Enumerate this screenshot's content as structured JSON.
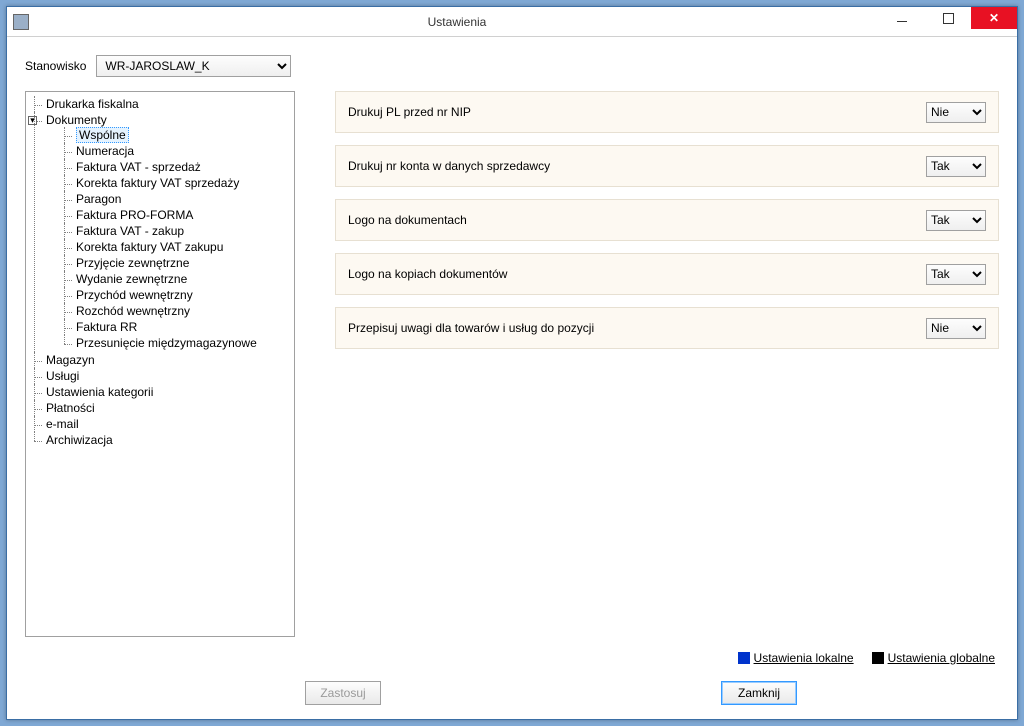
{
  "window": {
    "title": "Ustawienia"
  },
  "stanowisko": {
    "label": "Stanowisko",
    "value": "WR-JAROSLAW_K"
  },
  "tree": {
    "root": [
      {
        "label": "Drukarka fiskalna"
      },
      {
        "label": "Dokumenty",
        "expanded": true,
        "children": [
          {
            "label": "Wspólne",
            "selected": true
          },
          {
            "label": "Numeracja"
          },
          {
            "label": "Faktura VAT - sprzedaż"
          },
          {
            "label": "Korekta faktury VAT sprzedaży"
          },
          {
            "label": "Paragon"
          },
          {
            "label": "Faktura PRO-FORMA"
          },
          {
            "label": "Faktura VAT - zakup"
          },
          {
            "label": "Korekta faktury VAT zakupu"
          },
          {
            "label": "Przyjęcie zewnętrzne"
          },
          {
            "label": "Wydanie zewnętrzne"
          },
          {
            "label": "Przychód wewnętrzny"
          },
          {
            "label": "Rozchód wewnętrzny"
          },
          {
            "label": "Faktura RR"
          },
          {
            "label": "Przesunięcie międzymagazynowe"
          }
        ]
      },
      {
        "label": "Magazyn"
      },
      {
        "label": "Usługi"
      },
      {
        "label": "Ustawienia kategorii"
      },
      {
        "label": "Płatności"
      },
      {
        "label": "e-mail"
      },
      {
        "label": "Archiwizacja"
      }
    ]
  },
  "settings": [
    {
      "label": "Drukuj PL przed nr NIP",
      "value": "Nie"
    },
    {
      "label": "Drukuj nr konta w danych sprzedawcy",
      "value": "Tak"
    },
    {
      "label": "Logo na dokumentach",
      "value": "Tak"
    },
    {
      "label": "Logo na kopiach dokumentów",
      "value": "Tak"
    },
    {
      "label": "Przepisuj uwagi dla towarów i usług do pozycji",
      "value": "Nie"
    }
  ],
  "select_options": [
    "Tak",
    "Nie"
  ],
  "legend": {
    "local": "Ustawienia lokalne",
    "global": "Ustawienia globalne"
  },
  "buttons": {
    "apply": "Zastosuj",
    "close": "Zamknij"
  }
}
